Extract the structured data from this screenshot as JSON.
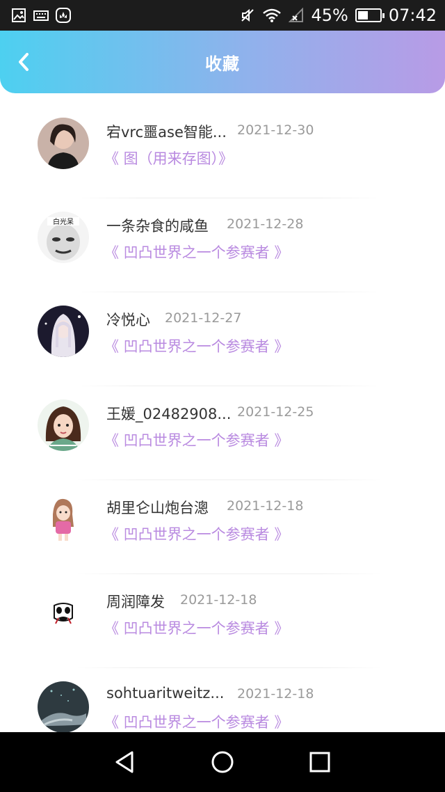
{
  "status_bar": {
    "battery": "45%",
    "time": "07:42",
    "icons": [
      "image-icon",
      "keyboard-icon",
      "huawei-icon",
      "mute-icon",
      "wifi-icon",
      "no-signal-icon",
      "battery-icon"
    ]
  },
  "header": {
    "title": "收藏",
    "back_icon": "chevron-left-icon",
    "gradient": [
      "#4dd0f0",
      "#b89be6"
    ]
  },
  "accent_color": "#b98ae0",
  "favorites": [
    {
      "name": "宕vrc噩ase智能...",
      "date": "2021-12-30",
      "work": "《 图（用来存图）》",
      "avatar": "woman-photo"
    },
    {
      "name": "一条杂食的咸鱼",
      "date": "2021-12-28",
      "work": "《 凹凸世界之一个参赛者 》",
      "avatar": "meme-face"
    },
    {
      "name": "冷悦心",
      "date": "2021-12-27",
      "work": "《 凹凸世界之一个参赛者 》",
      "avatar": "anime-girl"
    },
    {
      "name": "王媛_02482908...",
      "date": "2021-12-25",
      "work": "《 凹凸世界之一个参赛者 》",
      "avatar": "cartoon-girl"
    },
    {
      "name": "胡里仑山炮台漗",
      "date": "2021-12-18",
      "work": "《 凹凸世界之一个参赛者 》",
      "avatar": "cartoon-character"
    },
    {
      "name": "周润障发",
      "date": "2021-12-18",
      "work": "《 凹凸世界之一个参赛者 》",
      "avatar": "mask-face"
    },
    {
      "name": "sohtuaritweitz...",
      "date": "2021-12-18",
      "work": "《 凹凸世界之一个参赛者 》",
      "avatar": "hands-water"
    }
  ],
  "nav_bar": {
    "buttons": [
      "back-triangle-icon",
      "home-circle-icon",
      "recents-square-icon"
    ]
  }
}
